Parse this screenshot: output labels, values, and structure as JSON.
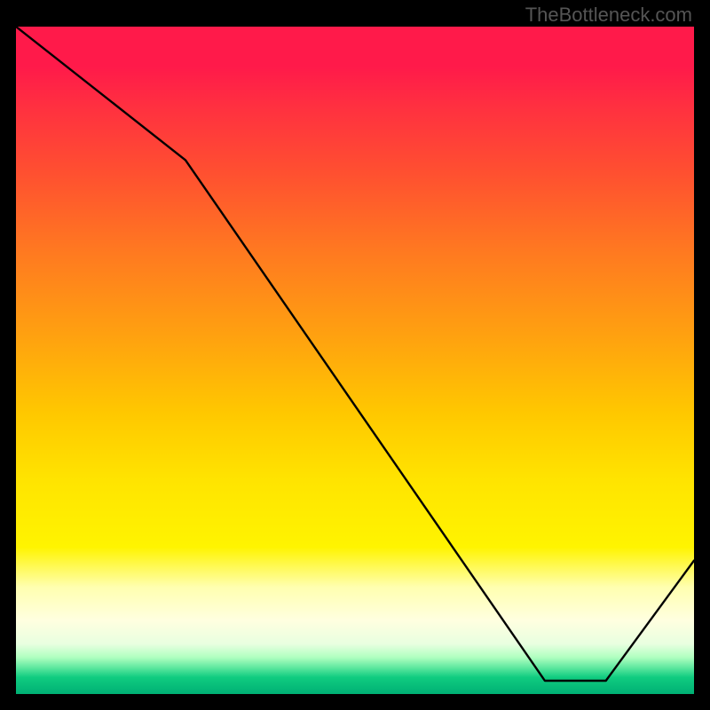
{
  "watermark": "TheBottleneck.com",
  "bottom_label": "",
  "chart_data": {
    "type": "line",
    "title": "",
    "xlabel": "",
    "ylabel": "",
    "xlim": [
      0,
      100
    ],
    "ylim": [
      0,
      1
    ],
    "x": [
      0,
      25,
      78,
      87,
      100
    ],
    "values": [
      1.0,
      0.8,
      0.02,
      0.02,
      0.2
    ],
    "annotations": [
      {
        "text": "",
        "x": 82,
        "y": 0.035
      }
    ],
    "gradient_stops": [
      {
        "pos": 0.0,
        "color": "#ff1a4a"
      },
      {
        "pos": 0.5,
        "color": "#ffc800"
      },
      {
        "pos": 0.88,
        "color": "#ffffe0"
      },
      {
        "pos": 0.96,
        "color": "#60e8a0"
      },
      {
        "pos": 1.0,
        "color": "#00b074"
      }
    ]
  }
}
